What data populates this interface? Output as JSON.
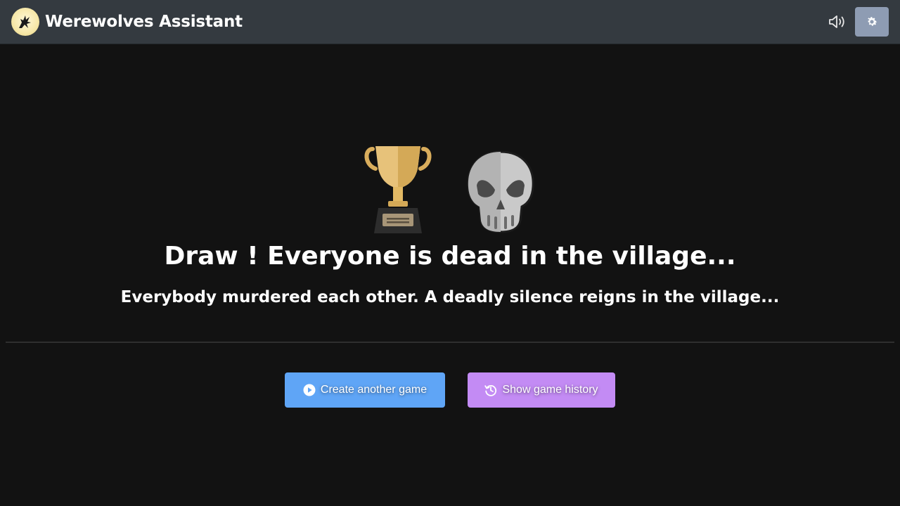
{
  "app": {
    "title": "Werewolves Assistant"
  },
  "header": {
    "sound_icon": "volume-icon",
    "settings_icon": "gear-icon"
  },
  "end_screen": {
    "icons": [
      "trophy-icon",
      "skull-icon"
    ],
    "title": "Draw ! Everyone is dead in the village...",
    "subtitle": "Everybody murdered each other. A deadly silence reigns in the village..."
  },
  "actions": {
    "create_label": "Create another game",
    "history_label": "Show game history"
  },
  "colors": {
    "navbar": "#343a40",
    "background": "#121212",
    "primary": "#5fa5f6",
    "history": "#c38bf4",
    "settings": "#8e9cb3"
  }
}
